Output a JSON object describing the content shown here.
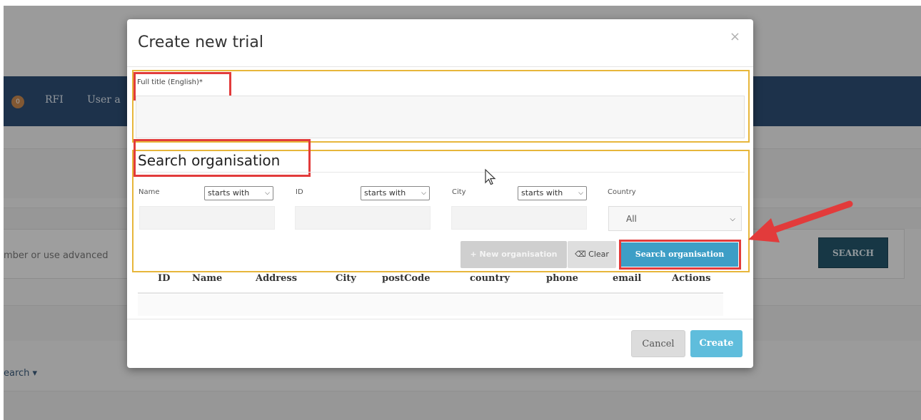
{
  "background": {
    "nav_badge": "0",
    "nav_items": [
      "RFI",
      "User a"
    ],
    "search_placeholder": "mber or use advanced",
    "search_button": "SEARCH",
    "advanced_search_link": "earch ▾"
  },
  "modal": {
    "title": "Create new trial",
    "close_icon": "×",
    "full_title_label": "Full title (English)*",
    "full_title_value": "",
    "search_section": {
      "heading": "Search organisation",
      "filters": [
        {
          "label": "Name",
          "operator": "starts with"
        },
        {
          "label": "ID",
          "operator": "starts with"
        },
        {
          "label": "City",
          "operator": "starts with"
        }
      ],
      "country_label": "Country",
      "country_value": "All",
      "buttons": {
        "new_organisation": "+ New organisation",
        "clear": "Clear",
        "search": "Search organisation"
      }
    },
    "table": {
      "columns": [
        "ID",
        "Name",
        "Address",
        "City",
        "postCode",
        "country",
        "phone",
        "email",
        "Actions"
      ],
      "rows": []
    },
    "footer": {
      "cancel": "Cancel",
      "create": "Create"
    }
  },
  "colors": {
    "navbar": "#2d4e73",
    "primary_button": "#3d9ec6",
    "create_button": "#5fbddc",
    "highlight_red": "#e23b3b",
    "highlight_yellow": "#e7b63b"
  }
}
